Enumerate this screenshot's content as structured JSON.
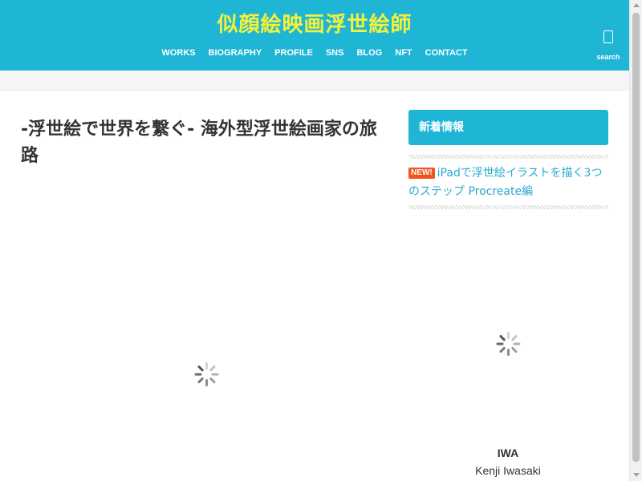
{
  "header": {
    "site_title": "似顔絵映画浮世絵師",
    "nav": [
      "WORKS",
      "BIOGRAPHY",
      "PROFILE",
      "SNS",
      "BLOG",
      "NFT",
      "CONTACT"
    ],
    "search_label": "search",
    "background_color": "#1fb6d6",
    "title_color": "#f2f23a"
  },
  "article": {
    "title": "-浮世絵で世界を繋ぐ- 海外型浮世絵画家の旅路"
  },
  "sidebar": {
    "heading": "新着情報",
    "news": [
      {
        "badge": "NEW!",
        "title": "iPadで浮世絵イラストを描く3つのステップ Procreate編"
      }
    ]
  },
  "profile": {
    "name": "IWA",
    "subname": "Kenji Iwasaki"
  },
  "icons": {
    "search": "search-icon",
    "loading": "loading-spinner-icon"
  }
}
